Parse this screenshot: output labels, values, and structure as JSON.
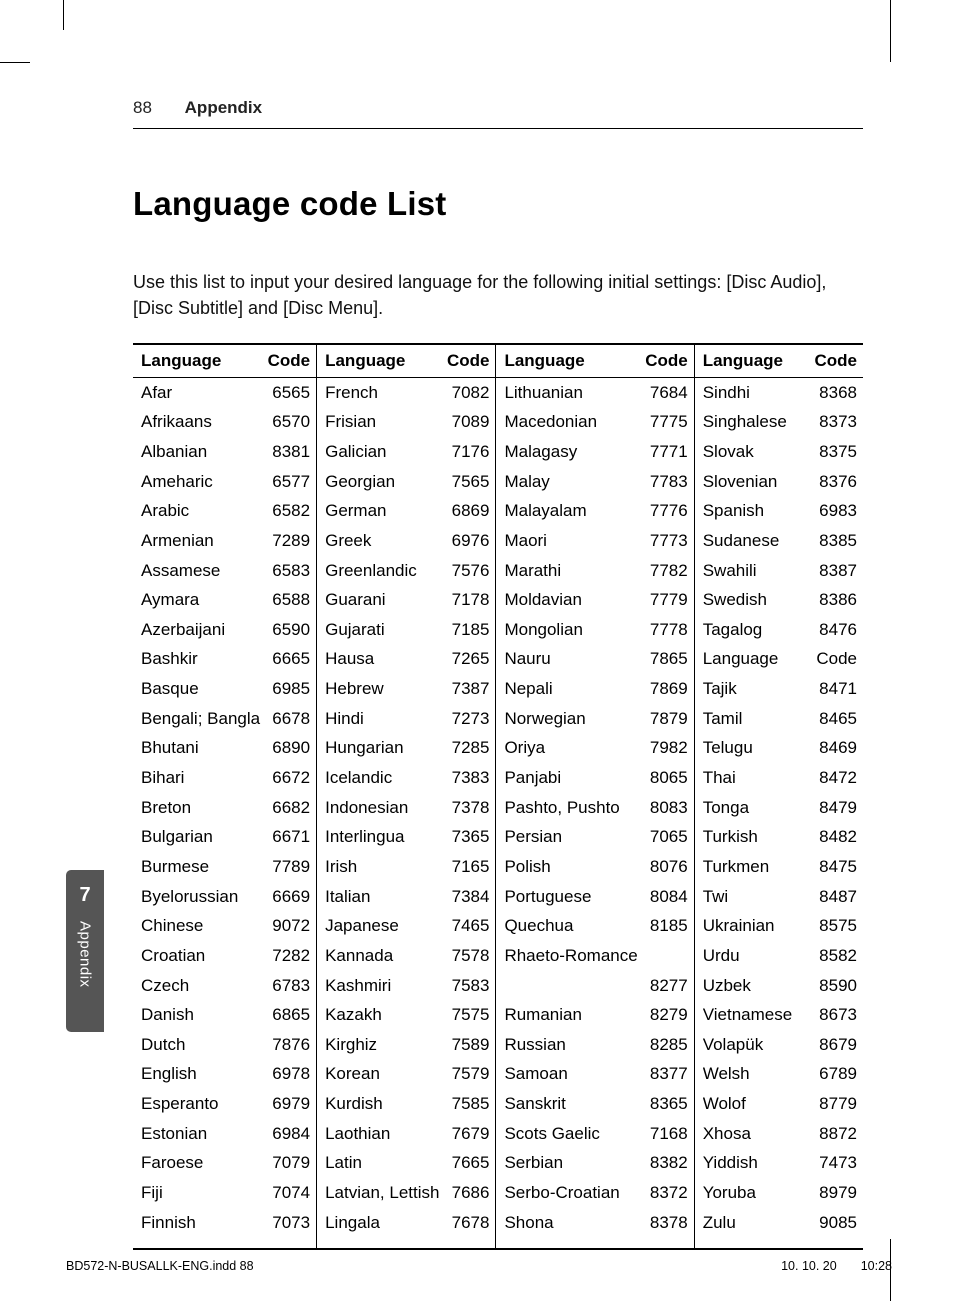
{
  "page_number": "88",
  "section_name": "Appendix",
  "title": "Language code List",
  "intro": "Use this list to input your desired language for the following initial settings: [Disc Audio], [Disc Subtitle] and [Disc Menu].",
  "header_lang": "Language",
  "header_code": "Code",
  "side_tab_number": "7",
  "side_tab_label": "Appendix",
  "footer_left": "BD572-N-BUSALLK-ENG.indd   88",
  "footer_date": "10. 10. 20",
  "footer_time": "10:28",
  "columns": [
    [
      {
        "lang": "Afar",
        "code": "6565"
      },
      {
        "lang": "Afrikaans",
        "code": "6570"
      },
      {
        "lang": "Albanian",
        "code": "8381"
      },
      {
        "lang": "Ameharic",
        "code": "6577"
      },
      {
        "lang": "Arabic",
        "code": "6582"
      },
      {
        "lang": "Armenian",
        "code": "7289"
      },
      {
        "lang": "Assamese",
        "code": "6583"
      },
      {
        "lang": "Aymara",
        "code": "6588"
      },
      {
        "lang": "Azerbaijani",
        "code": "6590"
      },
      {
        "lang": "Bashkir",
        "code": "6665"
      },
      {
        "lang": "Basque",
        "code": "6985"
      },
      {
        "lang": "Bengali; Bangla",
        "code": "6678"
      },
      {
        "lang": "Bhutani",
        "code": "6890"
      },
      {
        "lang": "Bihari",
        "code": "6672"
      },
      {
        "lang": "Breton",
        "code": "6682"
      },
      {
        "lang": "Bulgarian",
        "code": "6671"
      },
      {
        "lang": "Burmese",
        "code": "7789"
      },
      {
        "lang": "Byelorussian",
        "code": "6669"
      },
      {
        "lang": "Chinese",
        "code": "9072"
      },
      {
        "lang": "Croatian",
        "code": "7282"
      },
      {
        "lang": "Czech",
        "code": "6783"
      },
      {
        "lang": "Danish",
        "code": "6865"
      },
      {
        "lang": "Dutch",
        "code": "7876"
      },
      {
        "lang": "English",
        "code": "6978"
      },
      {
        "lang": "Esperanto",
        "code": "6979"
      },
      {
        "lang": "Estonian",
        "code": "6984"
      },
      {
        "lang": "Faroese",
        "code": "7079"
      },
      {
        "lang": "Fiji",
        "code": "7074"
      },
      {
        "lang": "Finnish",
        "code": "7073"
      }
    ],
    [
      {
        "lang": "French",
        "code": "7082"
      },
      {
        "lang": "Frisian",
        "code": "7089"
      },
      {
        "lang": "Galician",
        "code": "7176"
      },
      {
        "lang": "Georgian",
        "code": "7565"
      },
      {
        "lang": "German",
        "code": "6869"
      },
      {
        "lang": "Greek",
        "code": "6976"
      },
      {
        "lang": "Greenlandic",
        "code": "7576"
      },
      {
        "lang": "Guarani",
        "code": "7178"
      },
      {
        "lang": "Gujarati",
        "code": "7185"
      },
      {
        "lang": "Hausa",
        "code": "7265"
      },
      {
        "lang": "Hebrew",
        "code": "7387"
      },
      {
        "lang": "Hindi",
        "code": "7273"
      },
      {
        "lang": "Hungarian",
        "code": "7285"
      },
      {
        "lang": "Icelandic",
        "code": "7383"
      },
      {
        "lang": "Indonesian",
        "code": "7378"
      },
      {
        "lang": "Interlingua",
        "code": "7365"
      },
      {
        "lang": "Irish",
        "code": "7165"
      },
      {
        "lang": "Italian",
        "code": "7384"
      },
      {
        "lang": "Japanese",
        "code": "7465"
      },
      {
        "lang": "Kannada",
        "code": "7578"
      },
      {
        "lang": "Kashmiri",
        "code": "7583"
      },
      {
        "lang": "Kazakh",
        "code": "7575"
      },
      {
        "lang": "Kirghiz",
        "code": "7589"
      },
      {
        "lang": "Korean",
        "code": "7579"
      },
      {
        "lang": "Kurdish",
        "code": "7585"
      },
      {
        "lang": "Laothian",
        "code": "7679"
      },
      {
        "lang": "Latin",
        "code": "7665"
      },
      {
        "lang": "Latvian, Lettish",
        "code": "7686"
      },
      {
        "lang": "Lingala",
        "code": "7678"
      }
    ],
    [
      {
        "lang": "Lithuanian",
        "code": "7684"
      },
      {
        "lang": "Macedonian",
        "code": "7775"
      },
      {
        "lang": "Malagasy",
        "code": "7771"
      },
      {
        "lang": "Malay",
        "code": "7783"
      },
      {
        "lang": "Malayalam",
        "code": "7776"
      },
      {
        "lang": "Maori",
        "code": "7773"
      },
      {
        "lang": "Marathi",
        "code": "7782"
      },
      {
        "lang": "Moldavian",
        "code": "7779"
      },
      {
        "lang": "Mongolian",
        "code": "7778"
      },
      {
        "lang": "Nauru",
        "code": "7865"
      },
      {
        "lang": "Nepali",
        "code": "7869"
      },
      {
        "lang": "Norwegian",
        "code": "7879"
      },
      {
        "lang": "Oriya",
        "code": "7982"
      },
      {
        "lang": "Panjabi",
        "code": "8065"
      },
      {
        "lang": "Pashto, Pushto",
        "code": "8083"
      },
      {
        "lang": "Persian",
        "code": "7065"
      },
      {
        "lang": "Polish",
        "code": "8076"
      },
      {
        "lang": "Portuguese",
        "code": "8084"
      },
      {
        "lang": "Quechua",
        "code": "8185"
      },
      {
        "lang": "Rhaeto-Romance",
        "code": ""
      },
      {
        "lang": "",
        "code": "8277"
      },
      {
        "lang": "Rumanian",
        "code": "8279"
      },
      {
        "lang": "Russian",
        "code": "8285"
      },
      {
        "lang": "Samoan",
        "code": "8377"
      },
      {
        "lang": "Sanskrit",
        "code": "8365"
      },
      {
        "lang": "Scots Gaelic",
        "code": "7168"
      },
      {
        "lang": "Serbian",
        "code": "8382"
      },
      {
        "lang": "Serbo-Croatian",
        "code": "8372"
      },
      {
        "lang": "Shona",
        "code": "8378"
      }
    ],
    [
      {
        "lang": "Sindhi",
        "code": "8368"
      },
      {
        "lang": "Singhalese",
        "code": "8373"
      },
      {
        "lang": "Slovak",
        "code": "8375"
      },
      {
        "lang": "Slovenian",
        "code": "8376"
      },
      {
        "lang": "Spanish",
        "code": "6983"
      },
      {
        "lang": "Sudanese",
        "code": "8385"
      },
      {
        "lang": "Swahili",
        "code": "8387"
      },
      {
        "lang": "Swedish",
        "code": "8386"
      },
      {
        "lang": "Tagalog",
        "code": "8476"
      },
      {
        "lang": "Language",
        "code": "Code"
      },
      {
        "lang": "Tajik",
        "code": "8471"
      },
      {
        "lang": "Tamil",
        "code": "8465"
      },
      {
        "lang": "Telugu",
        "code": "8469"
      },
      {
        "lang": "Thai",
        "code": "8472"
      },
      {
        "lang": "Tonga",
        "code": "8479"
      },
      {
        "lang": "Turkish",
        "code": "8482"
      },
      {
        "lang": "Turkmen",
        "code": "8475"
      },
      {
        "lang": "Twi",
        "code": "8487"
      },
      {
        "lang": "Ukrainian",
        "code": "8575"
      },
      {
        "lang": "Urdu",
        "code": "8582"
      },
      {
        "lang": "Uzbek",
        "code": "8590"
      },
      {
        "lang": "Vietnamese",
        "code": "8673"
      },
      {
        "lang": "Volapük",
        "code": "8679"
      },
      {
        "lang": "Welsh",
        "code": "6789"
      },
      {
        "lang": "Wolof",
        "code": "8779"
      },
      {
        "lang": "Xhosa",
        "code": "8872"
      },
      {
        "lang": "Yiddish",
        "code": "7473"
      },
      {
        "lang": "Yoruba",
        "code": "8979"
      },
      {
        "lang": "Zulu",
        "code": "9085"
      }
    ]
  ]
}
